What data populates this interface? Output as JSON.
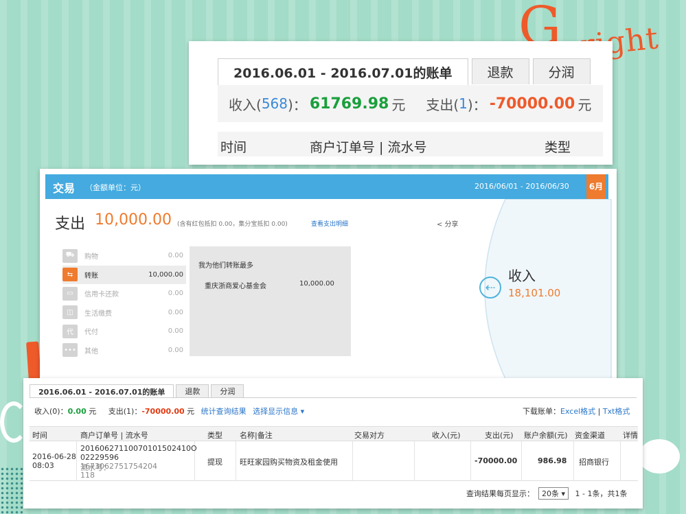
{
  "decor": {
    "letter_g": "G",
    "script_text": "right"
  },
  "panel1": {
    "tabs": [
      "2016.06.01 - 2016.07.01的账单",
      "退款",
      "分润"
    ],
    "summary": {
      "income_label": "收入(",
      "income_count": "568",
      "income_close": ")：",
      "income_amount": "61769.98",
      "yuan1": "元",
      "expense_label": "支出(",
      "expense_count": "1",
      "expense_close": ")：",
      "expense_amount": "-70000.00",
      "yuan2": "元"
    },
    "columns": [
      "时间",
      "商户订单号 | 流水号",
      "类型"
    ]
  },
  "panel2": {
    "title": "交易",
    "unit": "（金额单位：元）",
    "date_range": "2016/06/01 - 2016/06/30",
    "month_badge": "6月",
    "spend_label": "支出",
    "spend_value": "10,000.00",
    "spend_note": "(含有红包抵扣 0.00，集分宝抵扣 0.00)",
    "detail_link": "查看支出明细",
    "share": "分享",
    "categories": [
      {
        "icon": "cart-icon",
        "glyph": "⛟",
        "name": "购物",
        "amount": "0.00"
      },
      {
        "icon": "transfer-icon",
        "glyph": "⇆",
        "name": "转账",
        "amount": "10,000.00"
      },
      {
        "icon": "credit-card-icon",
        "glyph": "▭",
        "name": "信用卡还款",
        "amount": "0.00"
      },
      {
        "icon": "utilities-icon",
        "glyph": "◫",
        "name": "生活缴费",
        "amount": "0.00"
      },
      {
        "icon": "proxy-pay-icon",
        "glyph": "代",
        "name": "代付",
        "amount": "0.00"
      },
      {
        "icon": "more-icon",
        "glyph": "•••",
        "name": "其他",
        "amount": "0.00"
      }
    ],
    "detail_caption": "我为他们转账最多",
    "detail_name": "重庆浙商爱心基金会",
    "detail_value": "10,000.00",
    "income_label": "收入",
    "income_value": "18,101.00",
    "colors": {
      "accent_blue": "#44aadf",
      "accent_orange": "#ee7b2e"
    }
  },
  "panel3": {
    "tabs": [
      "2016.06.01 - 2016.07.01的账单",
      "退款",
      "分润"
    ],
    "summary": {
      "income": "收入(0)：",
      "income_amount": "0.00",
      "yuan1": "元",
      "expense": "支出(1)：",
      "expense_amount": "-70000.00",
      "yuan2": "元",
      "stats_link": "统计查询结果",
      "display_link": "选择显示信息 ▾"
    },
    "download": {
      "label": "下载账单：",
      "excel": "Excel格式",
      "sep": " | ",
      "txt": "Txt格式"
    },
    "columns": [
      "时间",
      "商户订单号 | 流水号",
      "类型",
      "名称|备注",
      "交易对方",
      "收入(元)",
      "支出(元)",
      "账户余额(元)",
      "资金渠道",
      "详情"
    ],
    "row": {
      "date": "2016-06-28",
      "time": "08:03",
      "order1": "20160627110070101502410O",
      "order2": "02229596",
      "serial_label": "流水号：",
      "serial1": "1673062751754204",
      "serial2": "118",
      "type": "提现",
      "name": "旺旺家园购买物资及租金使用",
      "expense": "-70000.00",
      "balance": "986.98",
      "channel": "招商银行"
    },
    "footer": {
      "label": "查询结果每页显示：",
      "per_page": "20条 ▾",
      "range": "1 - 1条，共1条"
    }
  }
}
